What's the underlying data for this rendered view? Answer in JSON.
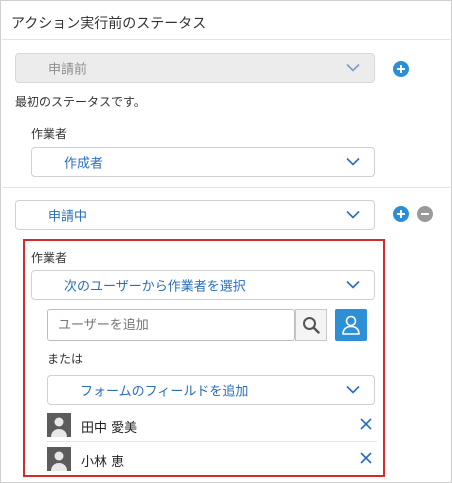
{
  "header": {
    "title": "アクション実行前のステータス"
  },
  "status_before": {
    "value": "申請前",
    "description": "最初のステータスです。"
  },
  "assignee_block_1": {
    "label": "作業者",
    "value": "作成者"
  },
  "status_in_progress": {
    "value": "申請中"
  },
  "assignee_block_2": {
    "label": "作業者",
    "selection": "次のユーザーから作業者を選択",
    "user_input_placeholder": "ユーザーを追加",
    "or_label": "または",
    "field_select": "フォームのフィールドを追加",
    "users": [
      {
        "name": "田中 愛美"
      },
      {
        "name": "小林 恵"
      }
    ]
  },
  "colors": {
    "accent": "#2a8fd8",
    "link": "#2a6ebb",
    "highlight_border": "#d62b2b",
    "muted_button": "#9a9a9a"
  },
  "icons": [
    "chevron-down-icon",
    "plus-icon",
    "minus-icon",
    "search-icon",
    "user-icon",
    "close-icon",
    "avatar-icon"
  ]
}
